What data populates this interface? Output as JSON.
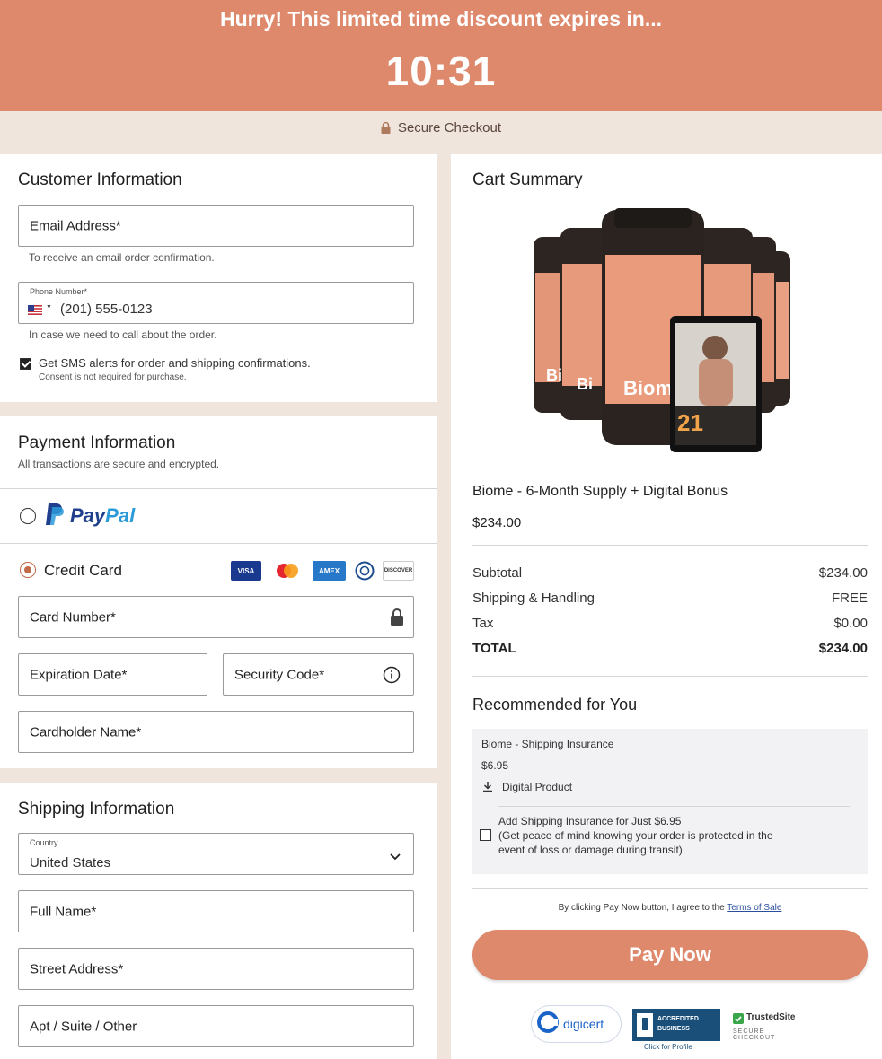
{
  "banner": {
    "text": "Hurry! This limited time discount expires in...",
    "timer": "10:31"
  },
  "secure_checkout": "Secure Checkout",
  "customer": {
    "title": "Customer Information",
    "email_label": "Email Address*",
    "email_hint": "To receive an email order confirmation.",
    "phone_mini_label": "Phone Number*",
    "phone_value": "(201) 555-0123",
    "phone_hint": "In case we need to call about the order.",
    "sms_label": "Get SMS alerts for order and shipping confirmations.",
    "sms_sub": "Consent is not required for purchase.",
    "sms_checked": true
  },
  "payment": {
    "title": "Payment Information",
    "subtitle": "All transactions are secure and encrypted.",
    "paypal_pay": "Pay",
    "paypal_pal": "Pal",
    "credit_card_label": "Credit Card",
    "card_brands": [
      "VISA",
      "mastercard",
      "AMEX",
      "Diners",
      "DISCOVER"
    ],
    "card_number_label": "Card Number*",
    "expiration_label": "Expiration Date*",
    "security_label": "Security Code*",
    "cardholder_label": "Cardholder Name*"
  },
  "shipping": {
    "title": "Shipping Information",
    "country_mini_label": "Country",
    "country_value": "United States",
    "full_name_label": "Full Name*",
    "street_label": "Street Address*",
    "apt_label": "Apt / Suite / Other"
  },
  "cart": {
    "title": "Cart Summary",
    "product_brand_text": "Biom",
    "product_tablet_number": "21",
    "product_name": "Biome - 6-Month Supply + Digital Bonus",
    "product_price": "$234.00",
    "subtotal_label": "Subtotal",
    "subtotal_value": "$234.00",
    "shipping_label": "Shipping & Handling",
    "shipping_value": "FREE",
    "tax_label": "Tax",
    "tax_value": "$0.00",
    "total_label": "TOTAL",
    "total_value": "$234.00"
  },
  "recommended": {
    "title": "Recommended for You",
    "item_name": "Biome - Shipping Insurance",
    "item_price": "$6.95",
    "item_type": "Digital Product",
    "addon_line1": "Add Shipping Insurance for Just $6.95",
    "addon_line2": "(Get peace of mind knowing your order is protected in the",
    "addon_line3": "event of loss or damage during transit)",
    "addon_checked": false
  },
  "terms": {
    "prefix": "By clicking Pay Now button, I agree to the ",
    "link": "Terms of Sale"
  },
  "pay_button": "Pay Now",
  "trust_badges": {
    "digicert": "digicert",
    "bbb_line1": "ACCREDITED",
    "bbb_line2": "BUSINESS",
    "bbb_sub": "Click for Profile",
    "trusted_site": "TrustedSite",
    "trusted_sub": "SECURE CHECKOUT"
  },
  "colors": {
    "accent": "#de896b",
    "radio_accent": "#c06a4a",
    "bg": "#efe5dc"
  }
}
